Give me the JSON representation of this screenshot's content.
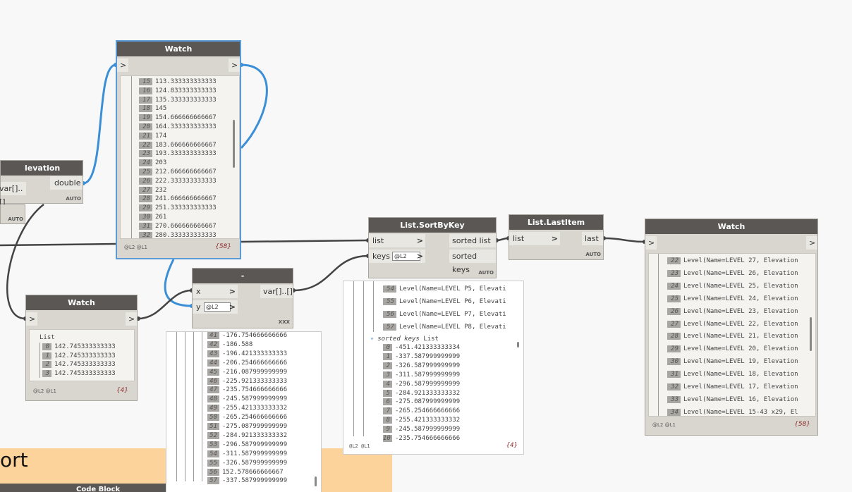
{
  "group": {
    "title": "ort",
    "code_block_title": "Code Block"
  },
  "elevation_node": {
    "title": "levation",
    "input_label": "var[]..[]",
    "output_label": "double",
    "auto": "AUTO",
    "left_auto": "AUTO"
  },
  "watch_top": {
    "title": "Watch",
    "in_chev": ">",
    "out_chev": ">",
    "rows": [
      {
        "i": "15",
        "v": "113.333333333333"
      },
      {
        "i": "16",
        "v": "124.833333333333"
      },
      {
        "i": "17",
        "v": "135.333333333333"
      },
      {
        "i": "18",
        "v": "145"
      },
      {
        "i": "19",
        "v": "154.666666666667"
      },
      {
        "i": "20",
        "v": "164.333333333333"
      },
      {
        "i": "21",
        "v": "174"
      },
      {
        "i": "22",
        "v": "183.666666666667"
      },
      {
        "i": "23",
        "v": "193.333333333333"
      },
      {
        "i": "24",
        "v": "203"
      },
      {
        "i": "25",
        "v": "212.666666666667"
      },
      {
        "i": "26",
        "v": "222.333333333333"
      },
      {
        "i": "27",
        "v": "232"
      },
      {
        "i": "28",
        "v": "241.666666666667"
      },
      {
        "i": "29",
        "v": "251.333333333333"
      },
      {
        "i": "30",
        "v": "261"
      },
      {
        "i": "31",
        "v": "270.666666666667"
      },
      {
        "i": "32",
        "v": "280.333333333333"
      }
    ],
    "lacing": "@L2 @L1",
    "count": "{58}"
  },
  "watch_small": {
    "title": "Watch",
    "in_chev": ">",
    "out_chev": ">",
    "list_label": "List",
    "rows": [
      {
        "i": "0",
        "v": "142.745333333333"
      },
      {
        "i": "1",
        "v": "142.745333333333"
      },
      {
        "i": "2",
        "v": "142.745333333333"
      },
      {
        "i": "3",
        "v": "142.745333333333"
      }
    ],
    "lacing": "@L2 @L1",
    "count": "{4}"
  },
  "minus_node": {
    "title": "-",
    "x_label": "x",
    "y_label": "y",
    "y_level": "@L2",
    "output_label": "var[]..[]",
    "footer": "XXX"
  },
  "minus_preview": {
    "rows": [
      {
        "i": "41",
        "v": "-176.754666666666"
      },
      {
        "i": "42",
        "v": "-186.588"
      },
      {
        "i": "43",
        "v": "-196.421333333333"
      },
      {
        "i": "44",
        "v": "-206.254666666666"
      },
      {
        "i": "45",
        "v": "-216.087999999999"
      },
      {
        "i": "46",
        "v": "-225.921333333333"
      },
      {
        "i": "47",
        "v": "-235.754666666666"
      },
      {
        "i": "48",
        "v": "-245.587999999999"
      },
      {
        "i": "49",
        "v": "-255.421333333332"
      },
      {
        "i": "50",
        "v": "-265.254666666666"
      },
      {
        "i": "51",
        "v": "-275.087999999999"
      },
      {
        "i": "52",
        "v": "-284.921333333332"
      },
      {
        "i": "53",
        "v": "-296.587999999999"
      },
      {
        "i": "54",
        "v": "-311.587999999999"
      },
      {
        "i": "55",
        "v": "-326.587999999999"
      },
      {
        "i": "56",
        "v": "152.578666666667"
      },
      {
        "i": "57",
        "v": "-337.587999999999"
      }
    ]
  },
  "sortbykey": {
    "title": "List.SortByKey",
    "in1": "list",
    "in2": "keys",
    "keys_level": "@L2",
    "out1": "sorted list",
    "out2": "sorted keys",
    "auto": "AUTO"
  },
  "sort_preview": {
    "top_rows": [
      {
        "i": "54",
        "v": "Level(Name=LEVEL P5, Elevati"
      },
      {
        "i": "55",
        "v": "Level(Name=LEVEL P6, Elevati"
      },
      {
        "i": "56",
        "v": "Level(Name=LEVEL P7, Elevati"
      },
      {
        "i": "57",
        "v": "Level(Name=LEVEL P8, Elevati"
      }
    ],
    "keys_header": "sorted keys",
    "keys_list": "List",
    "key_rows": [
      {
        "i": "0",
        "v": "-451.421333333334"
      },
      {
        "i": "1",
        "v": "-337.587999999999"
      },
      {
        "i": "2",
        "v": "-326.587999999999"
      },
      {
        "i": "3",
        "v": "-311.587999999999"
      },
      {
        "i": "4",
        "v": "-296.587999999999"
      },
      {
        "i": "5",
        "v": "-284.921333333332"
      },
      {
        "i": "6",
        "v": "-275.087999999999"
      },
      {
        "i": "7",
        "v": "-265.254666666666"
      },
      {
        "i": "8",
        "v": "-255.421333333332"
      },
      {
        "i": "9",
        "v": "-245.587999999999"
      },
      {
        "i": "10",
        "v": "-235.754666666666"
      }
    ],
    "lacing": "@L2 @L1",
    "count": "{4}"
  },
  "lastitem": {
    "title": "List.LastItem",
    "in1": "list",
    "out1": "last",
    "auto": "AUTO"
  },
  "watch_right": {
    "title": "Watch",
    "in_chev": ">",
    "out_chev": ">",
    "rows": [
      {
        "i": "22",
        "v": "Level(Name=LEVEL 27, Elevation"
      },
      {
        "i": "23",
        "v": "Level(Name=LEVEL 26, Elevation"
      },
      {
        "i": "24",
        "v": "Level(Name=LEVEL 25, Elevation"
      },
      {
        "i": "25",
        "v": "Level(Name=LEVEL 24, Elevation"
      },
      {
        "i": "26",
        "v": "Level(Name=LEVEL 23, Elevation"
      },
      {
        "i": "27",
        "v": "Level(Name=LEVEL 22, Elevation"
      },
      {
        "i": "28",
        "v": "Level(Name=LEVEL 21, Elevation"
      },
      {
        "i": "29",
        "v": "Level(Name=LEVEL 20, Elevation"
      },
      {
        "i": "30",
        "v": "Level(Name=LEVEL 19, Elevation"
      },
      {
        "i": "31",
        "v": "Level(Name=LEVEL 18, Elevation"
      },
      {
        "i": "32",
        "v": "Level(Name=LEVEL 17, Elevation"
      },
      {
        "i": "33",
        "v": "Level(Name=LEVEL 16, Elevation"
      },
      {
        "i": "34",
        "v": "Level(Name=LEVEL 15-43 x29, El"
      }
    ],
    "lacing": "@L2 @L1",
    "count": "{58}"
  }
}
